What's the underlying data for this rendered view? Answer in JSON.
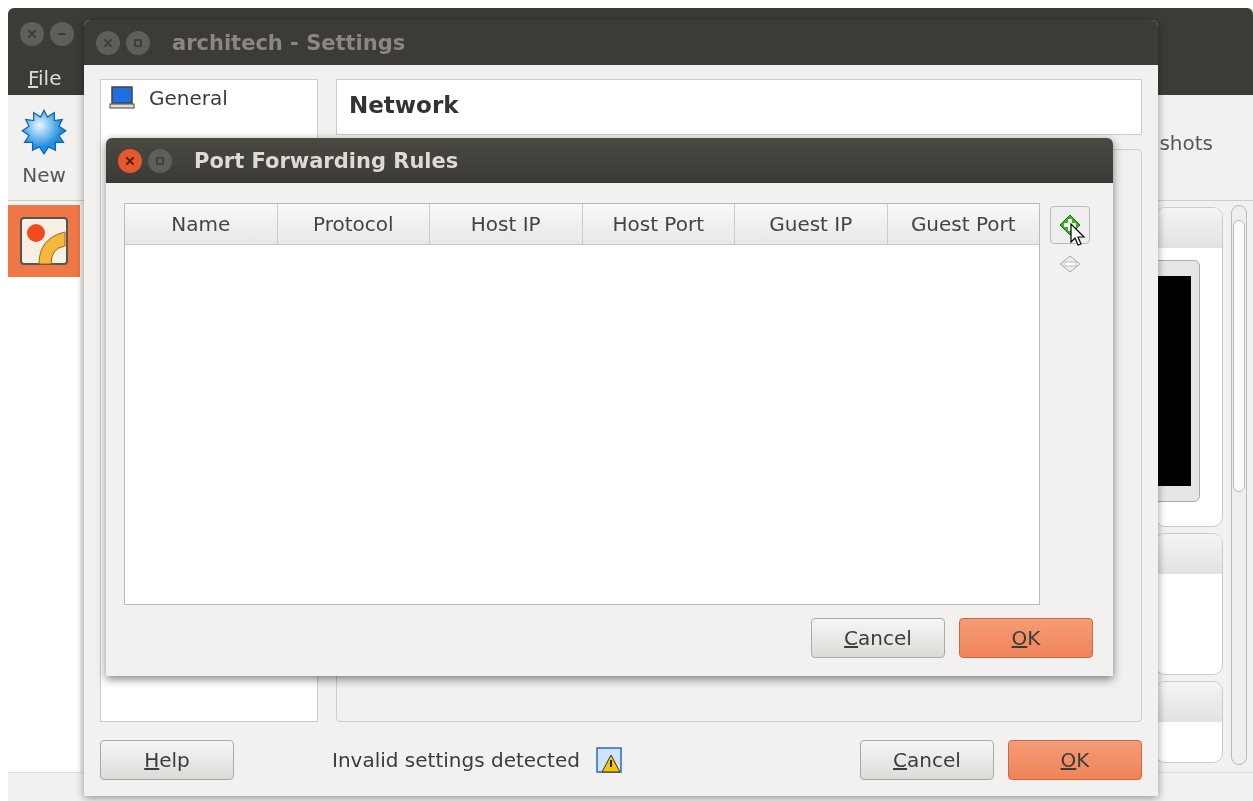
{
  "main_window": {
    "active": false,
    "menu": [
      "File"
    ],
    "toolbar": [
      {
        "label": "New"
      }
    ],
    "tab_fragment": "shots",
    "vm_list": [
      {
        "selected": true
      }
    ]
  },
  "settings_window": {
    "title": "architech - Settings",
    "active": false,
    "sections": [
      {
        "label": "General"
      }
    ],
    "page_title": "Network",
    "status": "Invalid settings detected",
    "buttons": [
      {
        "label": "Help",
        "kind": "plain"
      },
      {
        "label": "Cancel",
        "kind": "plain"
      },
      {
        "label": "OK",
        "kind": "default"
      }
    ]
  },
  "dialog": {
    "title": "Port Forwarding Rules",
    "active": true,
    "columns": [
      "Name",
      "Protocol",
      "Host IP",
      "Host Port",
      "Guest IP",
      "Guest Port"
    ],
    "buttons": [
      {
        "label": "Cancel",
        "kind": "plain"
      },
      {
        "label": "OK",
        "kind": "default"
      }
    ]
  }
}
